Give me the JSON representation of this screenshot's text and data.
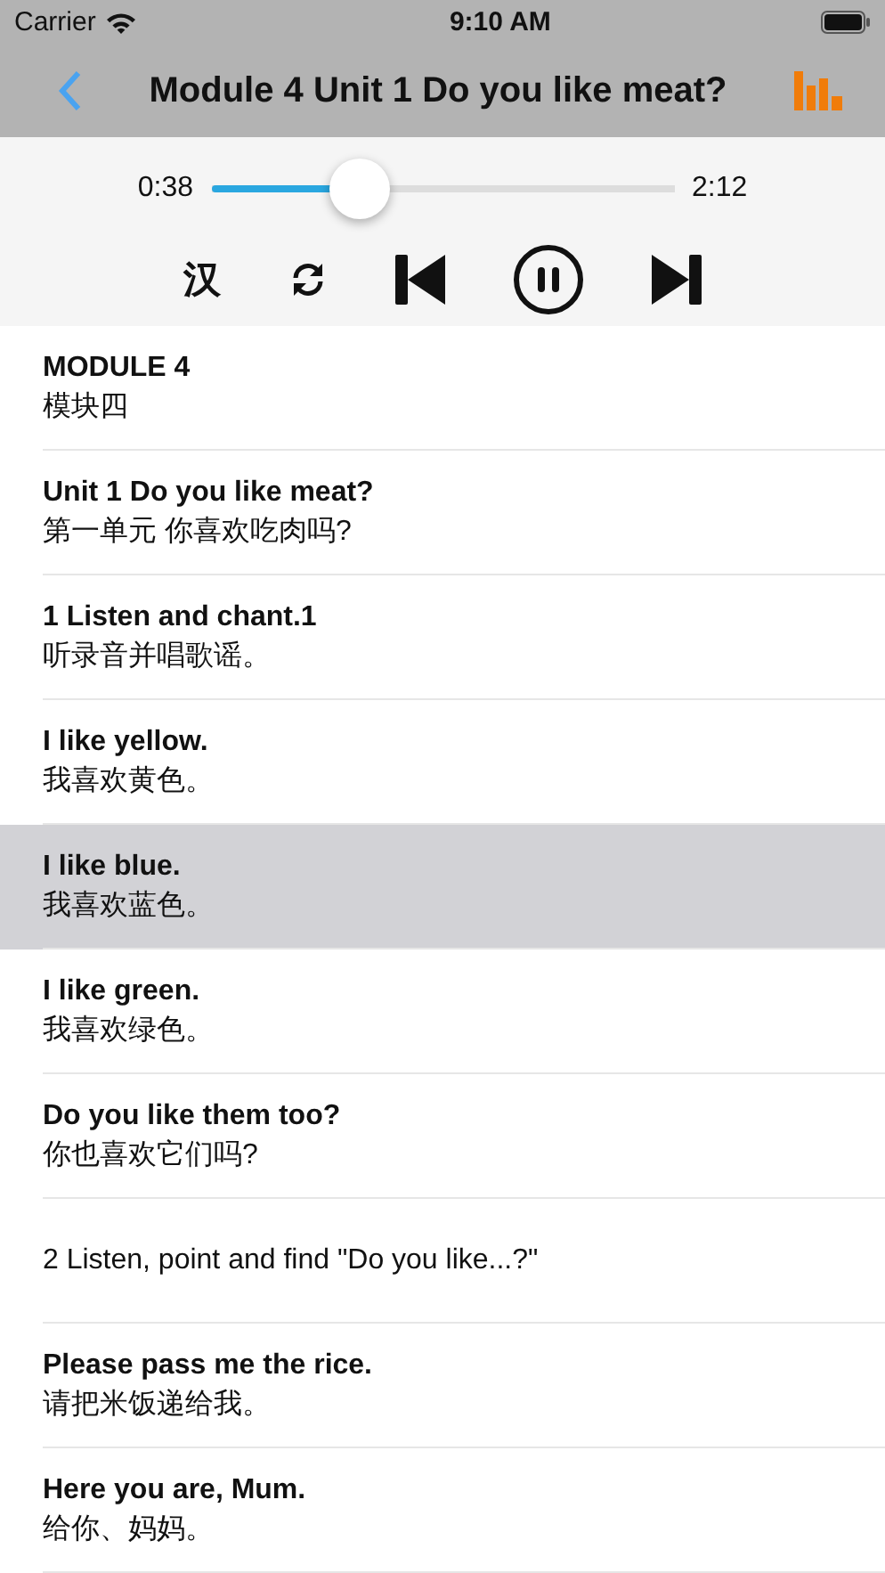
{
  "status_bar": {
    "carrier": "Carrier",
    "time": "9:10 AM"
  },
  "nav": {
    "title": "Module 4  Unit 1 Do you like meat?"
  },
  "player": {
    "elapsed": "0:38",
    "total": "2:12",
    "level": 0.32,
    "translation_button": "汉",
    "playing": true
  },
  "lines": [
    {
      "kind": "pair",
      "english": "MODULE 4",
      "chinese": "模块四",
      "selected": false
    },
    {
      "kind": "pair",
      "english": "Unit 1 Do you like meat?",
      "chinese": "第一单元 你喜欢吃肉吗?",
      "selected": false
    },
    {
      "kind": "pair",
      "english": "1 Listen and chant.1",
      "chinese": "听录音并唱歌谣。",
      "selected": false
    },
    {
      "kind": "pair",
      "english": "I like yellow.",
      "chinese": "我喜欢黄色。",
      "selected": false
    },
    {
      "kind": "pair",
      "english": "I like blue.",
      "chinese": "我喜欢蓝色。",
      "selected": true
    },
    {
      "kind": "pair",
      "english": "I like green.",
      "chinese": "我喜欢绿色。",
      "selected": false
    },
    {
      "kind": "pair",
      "english": "Do you like them too?",
      "chinese": "你也喜欢它们吗?",
      "selected": false
    },
    {
      "kind": "single",
      "english": "2 Listen, point and find \"Do you like...?\"",
      "selected": false
    },
    {
      "kind": "pair",
      "english": "Please pass me the rice.",
      "chinese": "请把米饭递给我。",
      "selected": false
    },
    {
      "kind": "pair",
      "english": "Here you are, Mum.",
      "chinese": "给你、妈妈。",
      "selected": false
    }
  ]
}
